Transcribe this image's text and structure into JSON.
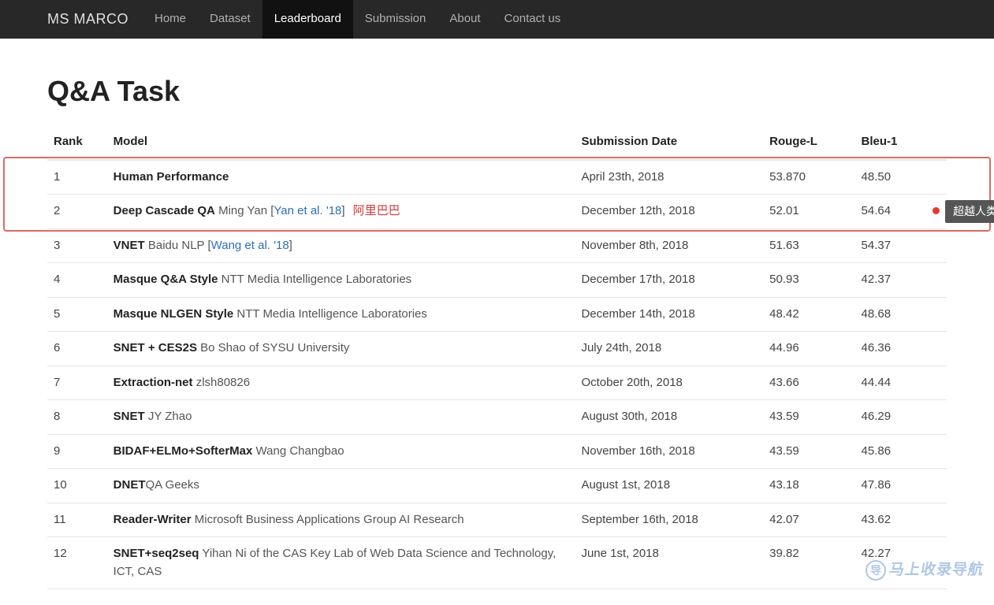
{
  "brand": "MS MARCO",
  "nav": [
    {
      "label": "Home",
      "active": false
    },
    {
      "label": "Dataset",
      "active": false
    },
    {
      "label": "Leaderboard",
      "active": true
    },
    {
      "label": "Submission",
      "active": false
    },
    {
      "label": "About",
      "active": false
    },
    {
      "label": "Contact us",
      "active": false
    }
  ],
  "page_title": "Q&A Task",
  "columns": {
    "rank": "Rank",
    "model": "Model",
    "date": "Submission Date",
    "rouge": "Rouge-L",
    "bleu": "Bleu-1"
  },
  "callout": "超越人类",
  "watermark": "马上收录导航",
  "rows": [
    {
      "rank": "1",
      "model_name": "Human Performance",
      "team": "",
      "paper": "",
      "extra": "",
      "date": "April 23th, 2018",
      "date_is_link": false,
      "rouge": "53.870",
      "bleu": "48.50"
    },
    {
      "rank": "2",
      "model_name": "Deep Cascade QA",
      "team": " Ming Yan ",
      "paper": "Yan et al. '18",
      "extra": "阿里巴巴",
      "date": "December 12th, 2018",
      "date_is_link": true,
      "rouge": "52.01",
      "bleu": "54.64"
    },
    {
      "rank": "3",
      "model_name": "VNET",
      "team": " Baidu NLP ",
      "paper": "Wang et al. '18",
      "extra": "",
      "date": "November 8th, 2018",
      "date_is_link": true,
      "rouge": "51.63",
      "bleu": "54.37"
    },
    {
      "rank": "4",
      "model_name": "Masque Q&A Style",
      "team": " NTT Media Intelligence Laboratories",
      "paper": "",
      "extra": "",
      "date": "December 17th, 2018",
      "date_is_link": true,
      "rouge": "50.93",
      "bleu": "42.37"
    },
    {
      "rank": "5",
      "model_name": "Masque NLGEN Style",
      "team": " NTT Media Intelligence Laboratories",
      "paper": "",
      "extra": "",
      "date": "December 14th, 2018",
      "date_is_link": true,
      "rouge": "48.42",
      "bleu": "48.68"
    },
    {
      "rank": "6",
      "model_name": "SNET + CES2S",
      "team": " Bo Shao of SYSU University",
      "paper": "",
      "extra": "",
      "date": "July 24th, 2018",
      "date_is_link": true,
      "rouge": "44.96",
      "bleu": "46.36"
    },
    {
      "rank": "7",
      "model_name": "Extraction-net",
      "team": " zlsh80826",
      "paper": "",
      "extra": "",
      "date": "October 20th, 2018",
      "date_is_link": true,
      "rouge": "43.66",
      "bleu": "44.44"
    },
    {
      "rank": "8",
      "model_name": "SNET",
      "team": " JY Zhao",
      "paper": "",
      "extra": "",
      "date": "August 30th, 2018",
      "date_is_link": true,
      "rouge": "43.59",
      "bleu": "46.29"
    },
    {
      "rank": "9",
      "model_name": "BIDAF+ELMo+SofterMax",
      "team": " Wang Changbao",
      "paper": "",
      "extra": "",
      "date": "November 16th, 2018",
      "date_is_link": true,
      "rouge": "43.59",
      "bleu": "45.86"
    },
    {
      "rank": "10",
      "model_name": "DNET",
      "team": "QA Geeks",
      "paper": "",
      "extra": "",
      "date": "August 1st, 2018",
      "date_is_link": true,
      "rouge": "43.18",
      "bleu": "47.86"
    },
    {
      "rank": "11",
      "model_name": "Reader-Writer",
      "team": " Microsoft Business Applications Group AI Research",
      "paper": "",
      "extra": "",
      "date": "September 16th, 2018",
      "date_is_link": true,
      "rouge": "42.07",
      "bleu": "43.62"
    },
    {
      "rank": "12",
      "model_name": "SNET+seq2seq",
      "team": " Yihan Ni of the CAS Key Lab of Web Data Science and Technology, ICT, CAS",
      "paper": "",
      "extra": "",
      "date": "June 1st, 2018",
      "date_is_link": true,
      "rouge": "39.82",
      "bleu": "42.27"
    }
  ]
}
